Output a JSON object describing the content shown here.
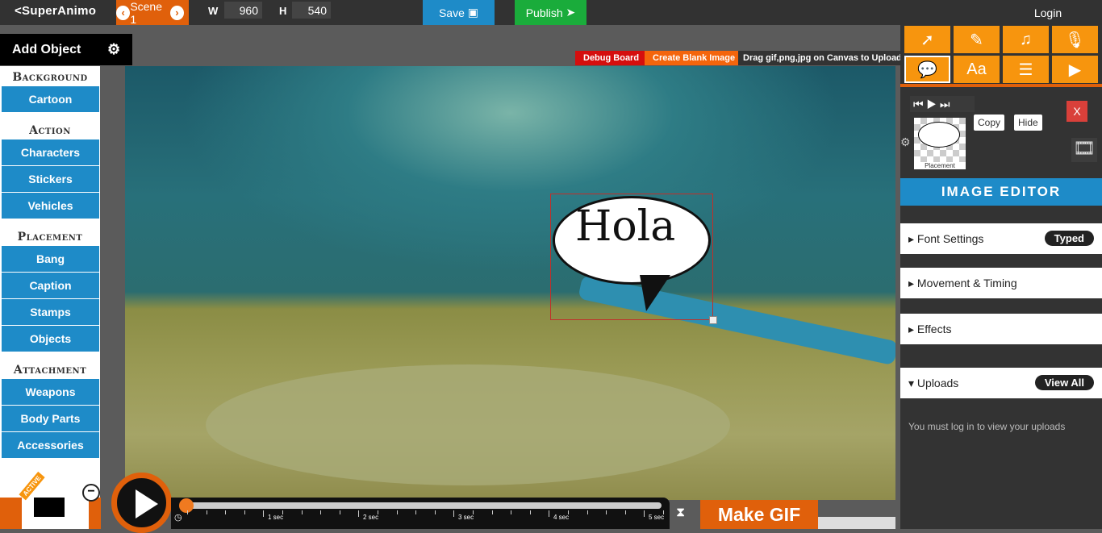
{
  "topbar": {
    "logo": "<SuperAnimo",
    "scene": "Scene 1",
    "w_label": "W",
    "w_value": "960",
    "h_label": "H",
    "h_value": "540",
    "save": "Save",
    "publish": "Publish",
    "login": "Login"
  },
  "sidebar": {
    "title": "Add Object",
    "sections": [
      {
        "label": "Background",
        "items": [
          "Cartoon"
        ]
      },
      {
        "label": "Action",
        "items": [
          "Characters",
          "Stickers",
          "Vehicles"
        ]
      },
      {
        "label": "Placement",
        "items": [
          "Bang",
          "Caption",
          "Stamps",
          "Objects"
        ]
      },
      {
        "label": "Attachment",
        "items": [
          "Weapons",
          "Body Parts",
          "Accessories"
        ]
      }
    ]
  },
  "canvas": {
    "debug": "Debug Board",
    "blank": "Create Blank Image",
    "drag": "Drag gif,png,jpg on Canvas to Upload",
    "bubble_text": "Hola"
  },
  "right": {
    "tools": [
      "pointer-icon",
      "pencil-icon",
      "music-icon",
      "microphone-icon",
      "speech-bubble-icon",
      "text-icon",
      "contact-card-icon",
      "youtube-icon"
    ],
    "copy": "Copy",
    "hide": "Hide",
    "close": "X",
    "placement": "Placement",
    "editor_title": "IMAGE EDITOR",
    "font_settings": "Font Settings",
    "font_badge": "Typed",
    "movement": "Movement & Timing",
    "effects": "Effects",
    "uploads": "Uploads",
    "view_all": "View All",
    "uploads_msg": "You must log in to view your uploads"
  },
  "timeline": {
    "ticks": [
      "1 sec",
      "2 sec",
      "3 sec",
      "4 sec",
      "5 sec"
    ],
    "active": "ACTIVE",
    "make_gif": "Make GIF",
    "progress": 0
  },
  "colors": {
    "orange": "#e0600b",
    "blue": "#1e8bc8",
    "green": "#1aac3b",
    "tool": "#f7950e"
  }
}
